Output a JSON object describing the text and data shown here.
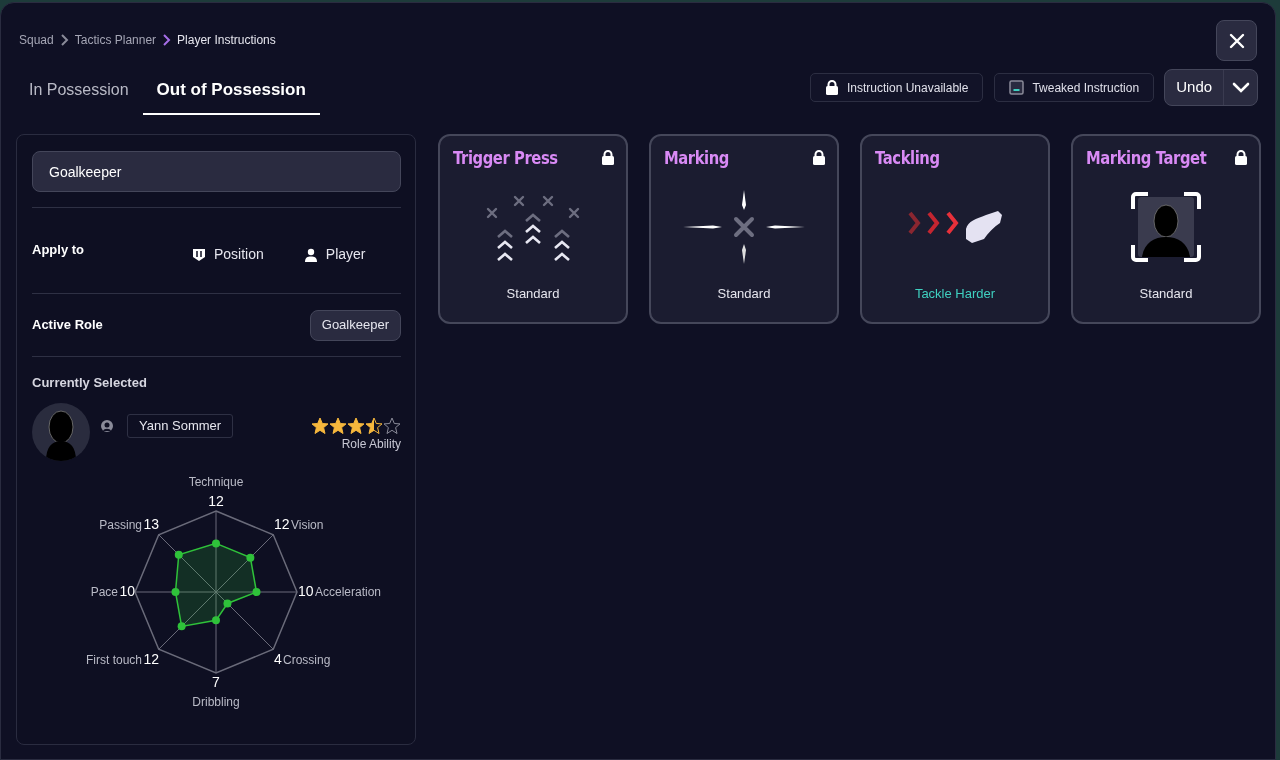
{
  "breadcrumb": [
    "Squad",
    "Tactics Planner",
    "Player Instructions"
  ],
  "tabs": [
    {
      "label": "In Possession",
      "selected": false
    },
    {
      "label": "Out of Possession",
      "selected": true
    }
  ],
  "legend": [
    {
      "kind": "locked",
      "label": "Instruction Unavailable"
    },
    {
      "kind": "tweaked",
      "label": "Tweaked Instruction"
    }
  ],
  "undo": {
    "label": "Undo"
  },
  "sidebar": {
    "position_field": {
      "value": "Goalkeeper"
    },
    "apply_to": {
      "label": "Apply to",
      "options": [
        {
          "kind": "position",
          "label": "Position"
        },
        {
          "kind": "player",
          "label": "Player"
        }
      ]
    },
    "active_role": {
      "label": "Active Role",
      "value": "Goalkeeper"
    },
    "currently_selected": {
      "label": "Currently Selected",
      "player": "Yann Sommer",
      "stars": 3.5,
      "stars_label": "Role Ability"
    },
    "stats": [
      {
        "label": "Technique",
        "value": "12"
      },
      {
        "label": "Passing",
        "value": "13"
      },
      {
        "label": "Vision",
        "value": "12"
      },
      {
        "label": "Pace",
        "value": "10"
      },
      {
        "label": "Acceleration",
        "value": "10"
      },
      {
        "label": "First touch",
        "value": "12"
      },
      {
        "label": "Crossing",
        "value": "4"
      },
      {
        "label": "Dribbling",
        "value": "7"
      }
    ]
  },
  "instructions": [
    {
      "kind": "press",
      "title": "Trigger Press",
      "locked": true,
      "tweaked": false,
      "value": "Standard"
    },
    {
      "kind": "marking",
      "title": "Marking",
      "locked": true,
      "tweaked": false,
      "value": "Standard"
    },
    {
      "kind": "tackle",
      "title": "Tackling",
      "locked": false,
      "tweaked": true,
      "value": "Tackle Harder"
    },
    {
      "kind": "target",
      "title": "Marking Target",
      "locked": true,
      "tweaked": false,
      "value": "Standard"
    }
  ]
}
